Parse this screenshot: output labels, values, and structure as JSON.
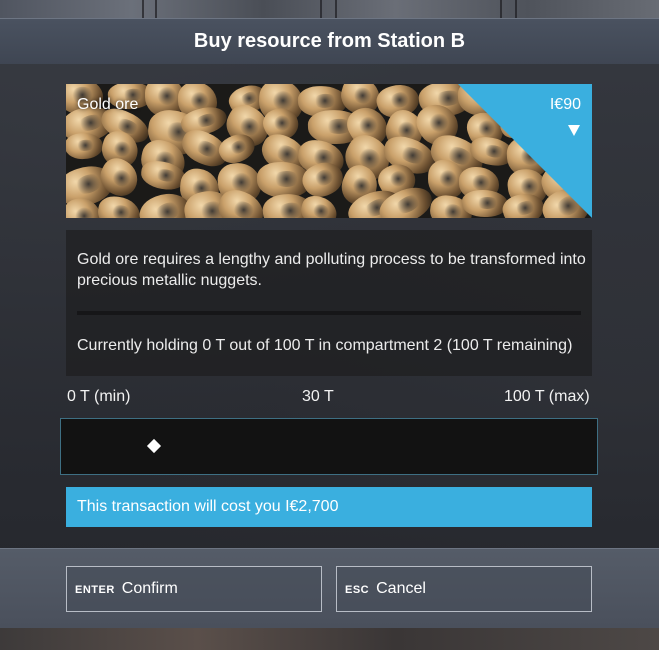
{
  "dialog": {
    "title": "Buy resource from Station B"
  },
  "resource": {
    "name": "Gold ore",
    "price": "Ι€90",
    "description": "Gold ore requires a lengthy and polluting process to be transformed into precious metallic nuggets.",
    "holding": "Currently holding 0 T out of 100 T in compartment 2 (100 T remaining)",
    "accent_color": "#3aafdf",
    "banner_icon": "chevron-down-icon"
  },
  "quantity": {
    "min_label": "0 T (min)",
    "current_label": "30 T",
    "max_label": "100 T (max)",
    "value": 30,
    "min": 0,
    "max": 100
  },
  "cost_text": "This transaction will cost you Ι€2,700",
  "actions": {
    "confirm": {
      "key": "ENTER",
      "label": "Confirm"
    },
    "cancel": {
      "key": "ESC",
      "label": "Cancel"
    }
  }
}
